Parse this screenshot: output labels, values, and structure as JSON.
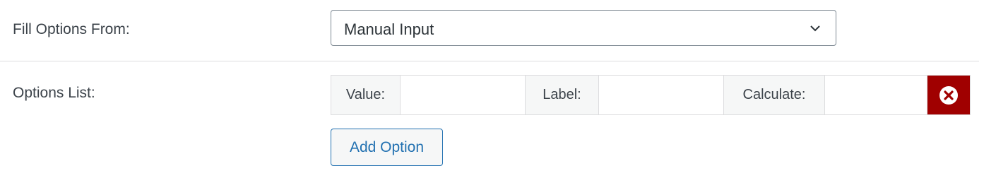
{
  "fill_options": {
    "label": "Fill Options From:",
    "selected": "Manual Input"
  },
  "options_list": {
    "label": "Options List:",
    "columns": {
      "value_label": "Value:",
      "label_label": "Label:",
      "calculate_label": "Calculate:"
    },
    "delete_icon": "close-circle-icon",
    "delete_color": "#a00000"
  },
  "add_option": {
    "label": "Add Option"
  }
}
